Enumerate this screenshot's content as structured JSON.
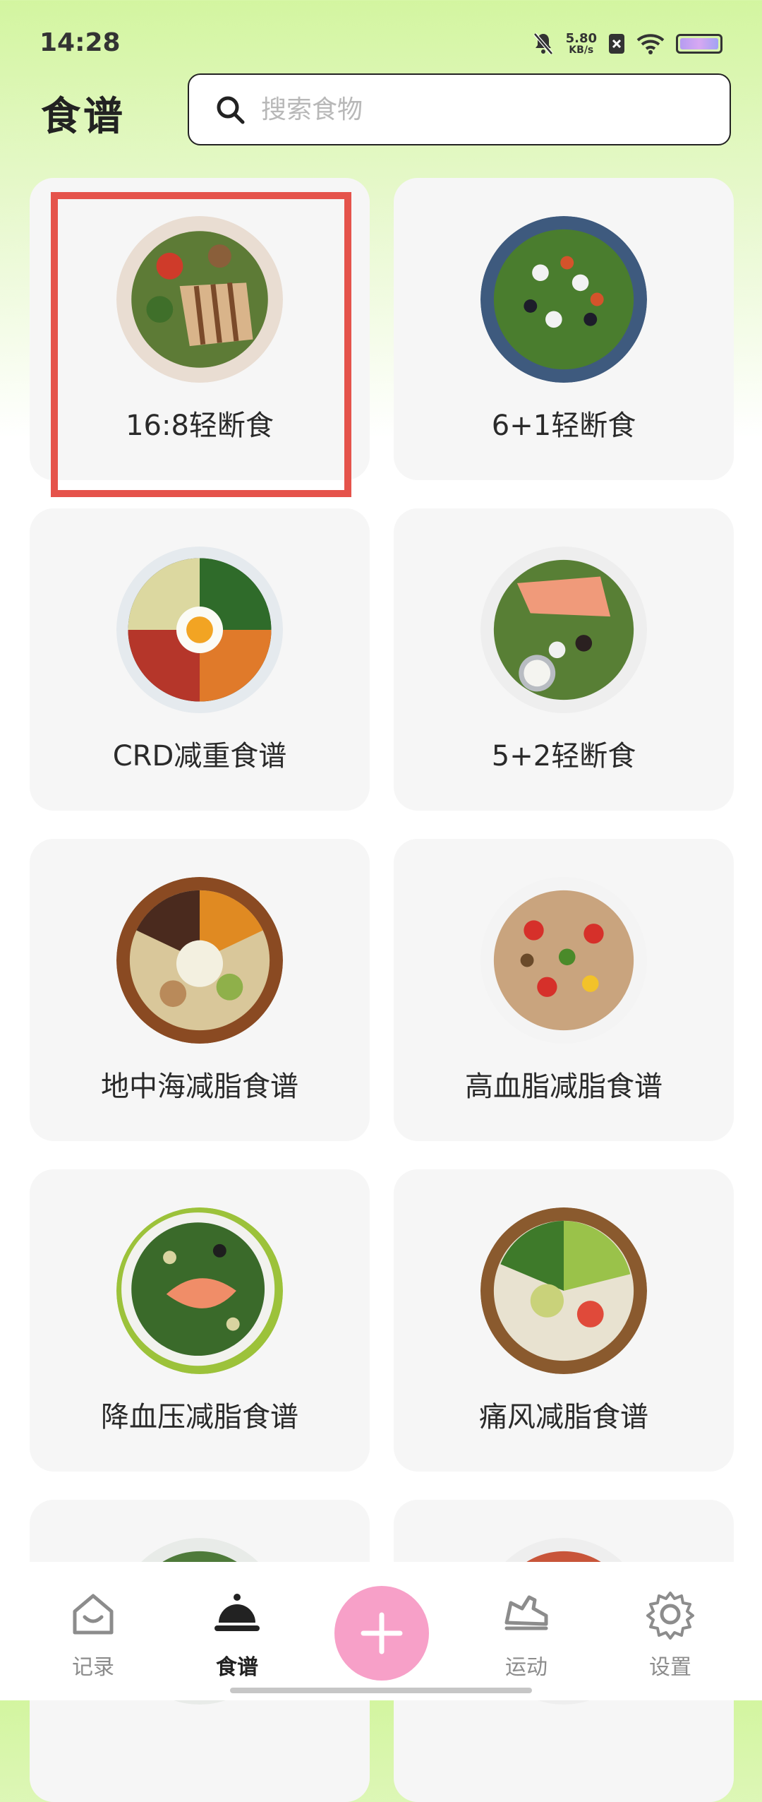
{
  "status_bar": {
    "time": "14:28",
    "net_speed_value": "5.80",
    "net_speed_unit": "KB/s"
  },
  "header": {
    "title": "食谱",
    "search_placeholder": "搜索食物"
  },
  "recipes": [
    {
      "label": "16:8轻断食",
      "highlighted": true
    },
    {
      "label": "6+1轻断食"
    },
    {
      "label": "CRD减重食谱"
    },
    {
      "label": "5+2轻断食"
    },
    {
      "label": "地中海减脂食谱"
    },
    {
      "label": "高血脂减脂食谱"
    },
    {
      "label": "降血压减脂食谱"
    },
    {
      "label": "痛风减脂食谱"
    }
  ],
  "bottom_nav": {
    "items": [
      {
        "label": "记录",
        "icon": "home-icon"
      },
      {
        "label": "食谱",
        "icon": "cloche-icon",
        "active": true
      },
      {
        "label": "",
        "icon": "plus-icon"
      },
      {
        "label": "运动",
        "icon": "shoe-icon"
      },
      {
        "label": "设置",
        "icon": "gear-icon"
      }
    ]
  },
  "colors": {
    "accent_pink": "#f7a0c8",
    "highlight_red": "#e5534b",
    "header_green": "#d3f5a0"
  }
}
